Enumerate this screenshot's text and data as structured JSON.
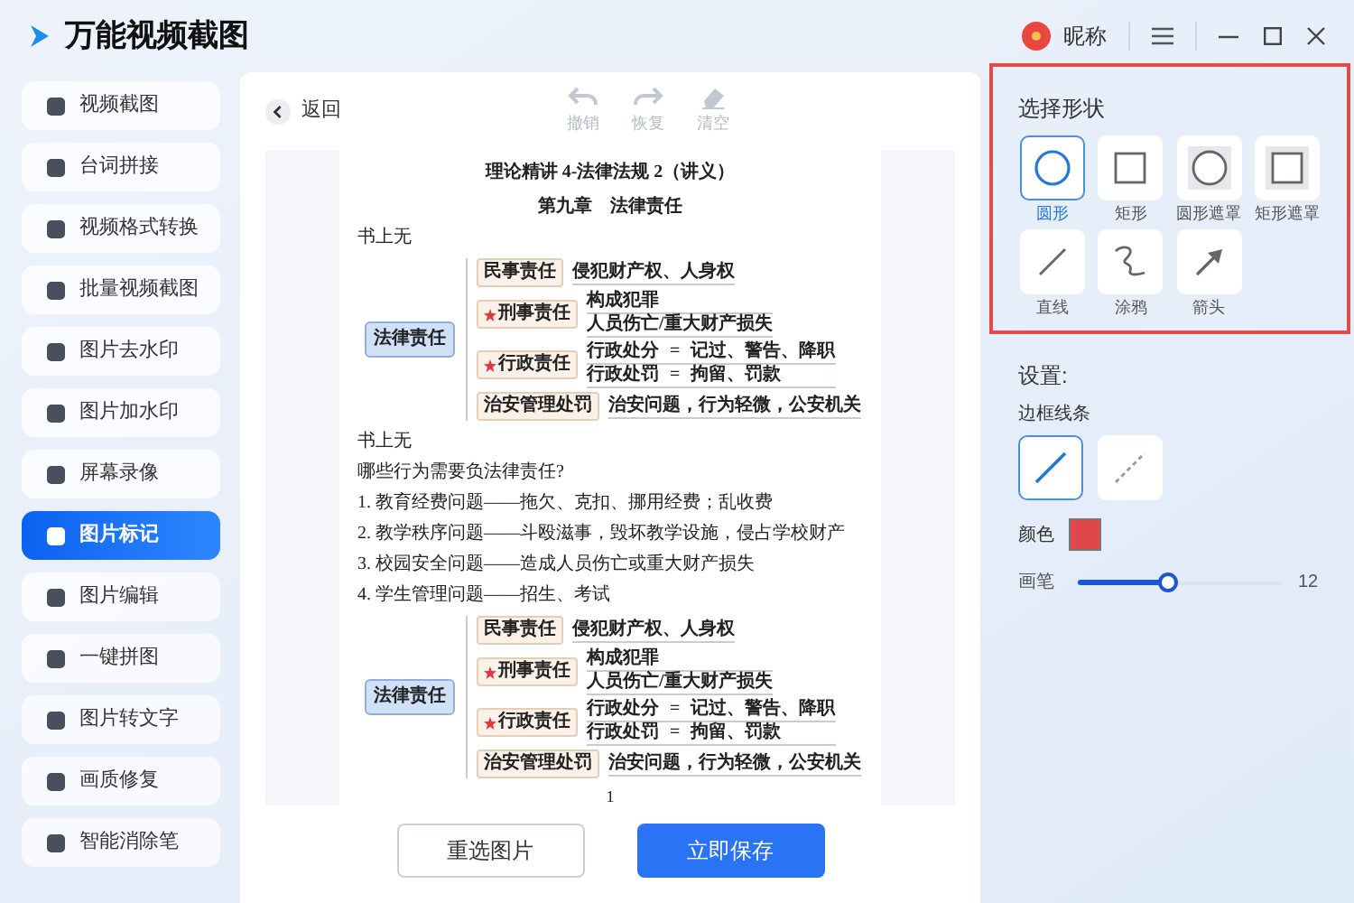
{
  "app": {
    "title": "万能视频截图",
    "user": "昵称"
  },
  "sidebar": {
    "items": [
      {
        "label": "视频截图",
        "selected": false
      },
      {
        "label": "台词拼接",
        "selected": false
      },
      {
        "label": "视频格式转换",
        "selected": false
      },
      {
        "label": "批量视频截图",
        "selected": false
      },
      {
        "label": "图片去水印",
        "selected": false
      },
      {
        "label": "图片加水印",
        "selected": false
      },
      {
        "label": "屏幕录像",
        "selected": false
      },
      {
        "label": "图片标记",
        "selected": true
      },
      {
        "label": "图片编辑",
        "selected": false
      },
      {
        "label": "一键拼图",
        "selected": false
      },
      {
        "label": "图片转文字",
        "selected": false
      },
      {
        "label": "画质修复",
        "selected": false
      },
      {
        "label": "智能消除笔",
        "selected": false
      }
    ]
  },
  "toolbar": {
    "back": "返回",
    "actions": [
      {
        "label": "撤销",
        "kind": "undo",
        "disabled": true
      },
      {
        "label": "恢复",
        "kind": "redo",
        "disabled": true
      },
      {
        "label": "清空",
        "kind": "eraser",
        "disabled": true
      }
    ]
  },
  "document": {
    "title": "理论精讲 4-法律法规 2（讲义）",
    "chapter": "第九章　法律责任",
    "blocks": [
      {
        "kind": "text",
        "text": "书上无"
      },
      {
        "kind": "mindmap",
        "root": "法律责任",
        "branches": [
          {
            "label": "民事责任",
            "starred": false,
            "details": [
              [
                "侵犯财产权、人身权"
              ]
            ]
          },
          {
            "label": "刑事责任",
            "starred": true,
            "details": [
              [
                "构成犯罪"
              ],
              [
                "人员伤亡/重大财产损失"
              ]
            ]
          },
          {
            "label": "行政责任",
            "starred": true,
            "details": [
              [
                "行政处分",
                "=",
                "记过、警告、降职"
              ],
              [
                "行政处罚",
                "=",
                "拘留、罚款"
              ]
            ]
          },
          {
            "label": "治安管理处罚",
            "starred": false,
            "details": [
              [
                "治安问题，行为轻微，公安机关"
              ]
            ]
          }
        ]
      },
      {
        "kind": "text",
        "text": "书上无"
      },
      {
        "kind": "text",
        "text": "哪些行为需要负法律责任?"
      },
      {
        "kind": "text",
        "text": "1. 教育经费问题——拖欠、克扣、挪用经费；乱收费"
      },
      {
        "kind": "text",
        "text": "2. 教学秩序问题——斗殴滋事，毁坏教学设施，侵占学校财产"
      },
      {
        "kind": "text",
        "text": "3. 校园安全问题——造成人员伤亡或重大财产损失"
      },
      {
        "kind": "text",
        "text": "4. 学生管理问题——招生、考试"
      },
      {
        "kind": "mindmap",
        "root": "法律责任",
        "branches": [
          {
            "label": "民事责任",
            "starred": false,
            "details": [
              [
                "侵犯财产权、人身权"
              ]
            ]
          },
          {
            "label": "刑事责任",
            "starred": true,
            "details": [
              [
                "构成犯罪"
              ],
              [
                "人员伤亡/重大财产损失"
              ]
            ]
          },
          {
            "label": "行政责任",
            "starred": true,
            "details": [
              [
                "行政处分",
                "=",
                "记过、警告、降职"
              ],
              [
                "行政处罚",
                "=",
                "拘留、罚款"
              ]
            ]
          },
          {
            "label": "治安管理处罚",
            "starred": false,
            "details": [
              [
                "治安问题，行为轻微，公安机关"
              ]
            ]
          }
        ]
      },
      {
        "kind": "page",
        "text": "1"
      }
    ]
  },
  "buttons": [
    {
      "label": "重选图片",
      "kind": "secondary"
    },
    {
      "label": "立即保存",
      "kind": "primary"
    }
  ],
  "shapes": {
    "title": "选择形状",
    "items": [
      {
        "label": "圆形",
        "kind": "circle",
        "selected": true
      },
      {
        "label": "矩形",
        "kind": "rect",
        "selected": false
      },
      {
        "label": "圆形遮罩",
        "kind": "circle-mask",
        "selected": false
      },
      {
        "label": "矩形遮罩",
        "kind": "rect-mask",
        "selected": false
      },
      {
        "label": "直线",
        "kind": "line",
        "selected": false
      },
      {
        "label": "涂鸦",
        "kind": "scribble",
        "selected": false
      },
      {
        "label": "箭头",
        "kind": "arrow",
        "selected": false
      }
    ]
  },
  "settings": {
    "title": "设置:",
    "border_label": "边框线条",
    "line_styles": [
      {
        "kind": "solid",
        "selected": true
      },
      {
        "kind": "dashed",
        "selected": false
      }
    ],
    "color_label": "颜色",
    "color": "#e0474c",
    "brush": {
      "label": "画笔",
      "level": 0.44,
      "reading": "12"
    }
  }
}
